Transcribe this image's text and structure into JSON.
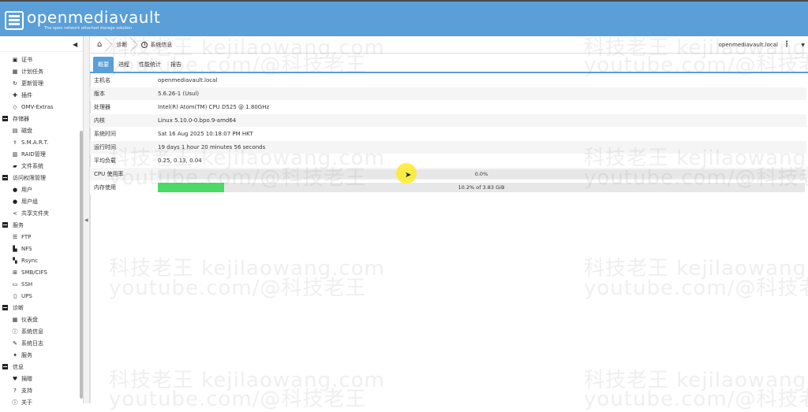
{
  "app": {
    "title": "openmediavault",
    "subtitle": "The open network attached storage solution"
  },
  "sidebar": {
    "items": [
      {
        "type": "item",
        "icon": "certificate-icon",
        "glyph": "▣",
        "label": "证书"
      },
      {
        "type": "item",
        "icon": "calendar-icon",
        "glyph": "▦",
        "label": "计划任务"
      },
      {
        "type": "item",
        "icon": "update-icon",
        "glyph": "↻",
        "label": "更新管理"
      },
      {
        "type": "item",
        "icon": "plugin-icon",
        "glyph": "✚",
        "label": "插件"
      },
      {
        "type": "item",
        "icon": "extras-icon",
        "glyph": "◇",
        "label": "OMV-Extras"
      },
      {
        "type": "group",
        "label": "存储器"
      },
      {
        "type": "item",
        "icon": "disk-icon",
        "glyph": "▤",
        "label": "磁盘"
      },
      {
        "type": "item",
        "icon": "smart-icon",
        "glyph": "⚕",
        "label": "S.M.A.R.T."
      },
      {
        "type": "item",
        "icon": "raid-icon",
        "glyph": "▥",
        "label": "RAID管理"
      },
      {
        "type": "item",
        "icon": "filesystem-icon",
        "glyph": "▰",
        "label": "文件系统"
      },
      {
        "type": "group",
        "label": "访问权限管理"
      },
      {
        "type": "item",
        "icon": "user-icon",
        "glyph": "●",
        "label": "用户"
      },
      {
        "type": "item",
        "icon": "group-icon",
        "glyph": "●",
        "label": "用户组"
      },
      {
        "type": "item",
        "icon": "share-icon",
        "glyph": "<",
        "label": "共享文件夹"
      },
      {
        "type": "group",
        "label": "服务"
      },
      {
        "type": "item",
        "icon": "ftp-icon",
        "glyph": "☰",
        "label": "FTP"
      },
      {
        "type": "item",
        "icon": "nfs-icon",
        "glyph": "▙",
        "label": "NFS"
      },
      {
        "type": "item",
        "icon": "rsync-icon",
        "glyph": "▚",
        "label": "Rsync"
      },
      {
        "type": "item",
        "icon": "windows-icon",
        "glyph": "⊞",
        "label": "SMB/CIFS"
      },
      {
        "type": "item",
        "icon": "terminal-icon",
        "glyph": "▭",
        "label": "SSH"
      },
      {
        "type": "item",
        "icon": "ups-icon",
        "glyph": "▯",
        "label": "UPS"
      },
      {
        "type": "group",
        "label": "诊断"
      },
      {
        "type": "item",
        "icon": "dashboard-icon",
        "glyph": "▦",
        "label": "仪表盘"
      },
      {
        "type": "item",
        "icon": "info-icon",
        "glyph": "ⓘ",
        "label": "系统信息"
      },
      {
        "type": "item",
        "icon": "log-icon",
        "glyph": "✎",
        "label": "系统日志"
      },
      {
        "type": "item",
        "icon": "wrench-icon",
        "glyph": "✦",
        "label": "服务"
      },
      {
        "type": "group",
        "label": "信息"
      },
      {
        "type": "item",
        "icon": "heart-icon",
        "glyph": "♥",
        "label": "捐赠"
      },
      {
        "type": "item",
        "icon": "help-icon",
        "glyph": "?",
        "label": "支持"
      },
      {
        "type": "item",
        "icon": "about-icon",
        "glyph": "ⓘ",
        "label": "关于"
      }
    ]
  },
  "breadcrumb": {
    "home_icon": "home-icon",
    "diag": "诊断",
    "sysinfo": "系统信息"
  },
  "header_right": {
    "hostname": "openmediavault.local"
  },
  "tabs": [
    {
      "label": "概要",
      "active": true
    },
    {
      "label": "进程",
      "active": false
    },
    {
      "label": "性能统计",
      "active": false
    },
    {
      "label": "报告",
      "active": false
    }
  ],
  "info_rows": [
    {
      "key": "主机名",
      "value": "openmediavault.local"
    },
    {
      "key": "版本",
      "value": "5.6.26-1 (Usul)"
    },
    {
      "key": "处理器",
      "value": "Intel(R) Atom(TM) CPU D525 @ 1.80GHz"
    },
    {
      "key": "内核",
      "value": "Linux 5.10.0-0.bpo.9-amd64"
    },
    {
      "key": "系统时间",
      "value": "Sat 16 Aug 2025 10:18:07 PM HKT"
    },
    {
      "key": "运行时间",
      "value": "19 days 1 hour 20 minutes 56 seconds"
    },
    {
      "key": "平均负载",
      "value": "0.25, 0.13, 0.04"
    }
  ],
  "cpu": {
    "key": "CPU 使用率",
    "text": "0.0%",
    "fraction": 0.0
  },
  "memory": {
    "key": "内存使用",
    "text": "10.2% of 3.83 GiB",
    "fraction": 0.102
  },
  "colors": {
    "header": "#5a9fd8",
    "memory_bar": "#4cd964",
    "cursor_highlight": "#faeb28"
  },
  "watermark": {
    "line1": "科技老王 kejilaowang.com",
    "line2": "youtube.com/@科技老王"
  }
}
